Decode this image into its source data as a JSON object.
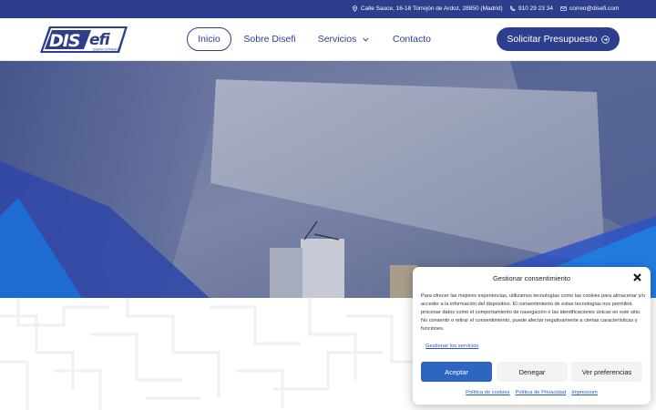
{
  "topbar": {
    "address": "Calle Sauce, 16-18 Torrejón de Ardoz, 28850 (Madrid)",
    "phone": "910 29 23 34",
    "email": "correo@disefi.com",
    "icons": [
      "location-icon",
      "phone-icon",
      "mail-icon"
    ]
  },
  "header": {
    "logo": {
      "main": "DIS",
      "accent": "efi",
      "tagline": "DISEÑO EFÍMERO"
    },
    "nav": [
      {
        "label": "Inicio",
        "active": true
      },
      {
        "label": "Sobre Disefi"
      },
      {
        "label": "Servicios",
        "has_dropdown": true
      },
      {
        "label": "Contacto"
      }
    ],
    "cta": "Solicitar Presupuesto"
  },
  "cookie": {
    "title": "Gestionar consentimiento",
    "body": "Para ofrecer las mejores experiencias, utilizamos tecnologías como las cookies para almacenar y/o acceder a la información del dispositivo. El consentimiento de estas tecnologías nos permitirá procesar datos como el comportamiento de navegación o las identificaciones únicas en este sitio. No consentir o retirar el consentimiento, puede afectar negativamente a ciertas características y funciones.",
    "manage_services": "Gestionar los servicios",
    "accept": "Aceptar",
    "deny": "Denegar",
    "preferences": "Ver preferencias",
    "links": [
      "Política de cookies",
      "Política de Privacidad",
      "Impressum"
    ]
  },
  "colors": {
    "brand": "#2d3e8c",
    "accept": "#2d66c0",
    "link": "#2d59b8"
  }
}
